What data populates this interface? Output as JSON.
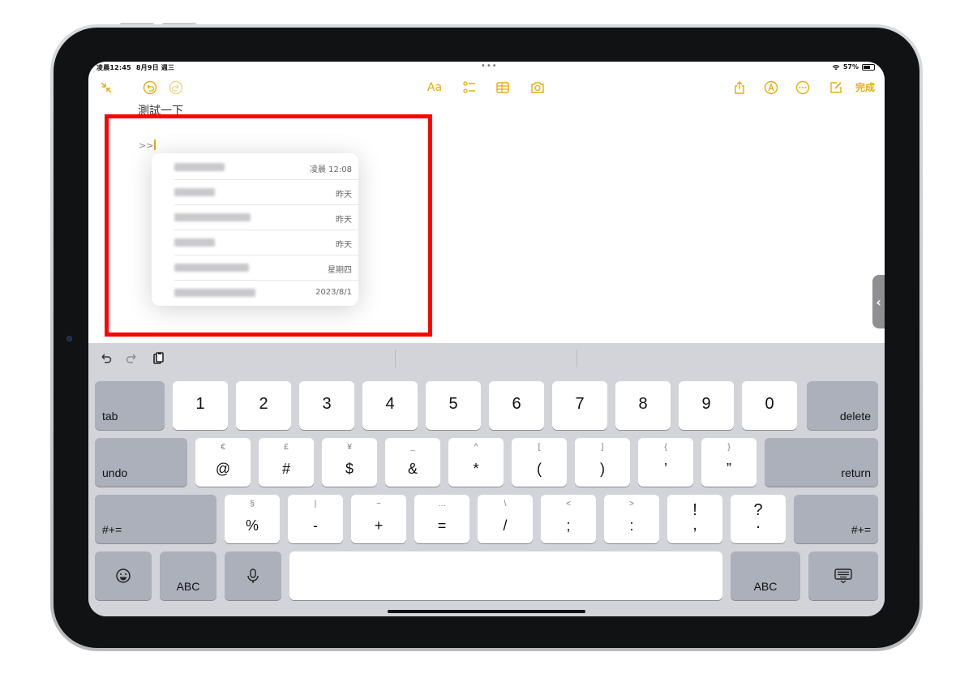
{
  "status": {
    "time": "凌晨12:45",
    "date": "8月9日 週三",
    "battery": "57%"
  },
  "toolbar": {
    "format_label": "Aa",
    "done_label": "完成"
  },
  "note": {
    "title": "測試一下",
    "typed_text": ">>"
  },
  "link_suggestions": [
    {
      "date": "凌晨 12:08"
    },
    {
      "date": "昨天"
    },
    {
      "date": "昨天"
    },
    {
      "date": "昨天"
    },
    {
      "date": "星期四"
    },
    {
      "date": "2023/8/1"
    }
  ],
  "keyboard": {
    "row1": [
      "1",
      "2",
      "3",
      "4",
      "5",
      "6",
      "7",
      "8",
      "9",
      "0"
    ],
    "row2_sub": [
      "€",
      "£",
      "¥",
      "_",
      "^",
      "[",
      "]",
      "{",
      "}"
    ],
    "row2_main": [
      "@",
      "#",
      "$",
      "&",
      "*",
      "(",
      ")",
      "’",
      "”"
    ],
    "row3_sub": [
      "§",
      "|",
      "~",
      "…",
      "\\",
      "<",
      ">"
    ],
    "row3_main": [
      "%",
      "-",
      "+",
      "=",
      "/",
      ";",
      ":"
    ],
    "row3_exclaim": "!",
    "row3_exclaim_sub": ",",
    "row3_question": "?",
    "row3_question_sub": ".",
    "tab_label": "tab",
    "delete_label": "delete",
    "undo_label": "undo",
    "return_label": "return",
    "more_symbols_label": "#+=",
    "abc_label": "ABC"
  },
  "colors": {
    "accent": "#e4ad0b",
    "highlight": "#ff0000",
    "keyboard_bg": "#d2d4da",
    "dark_key": "#abb0ba"
  }
}
